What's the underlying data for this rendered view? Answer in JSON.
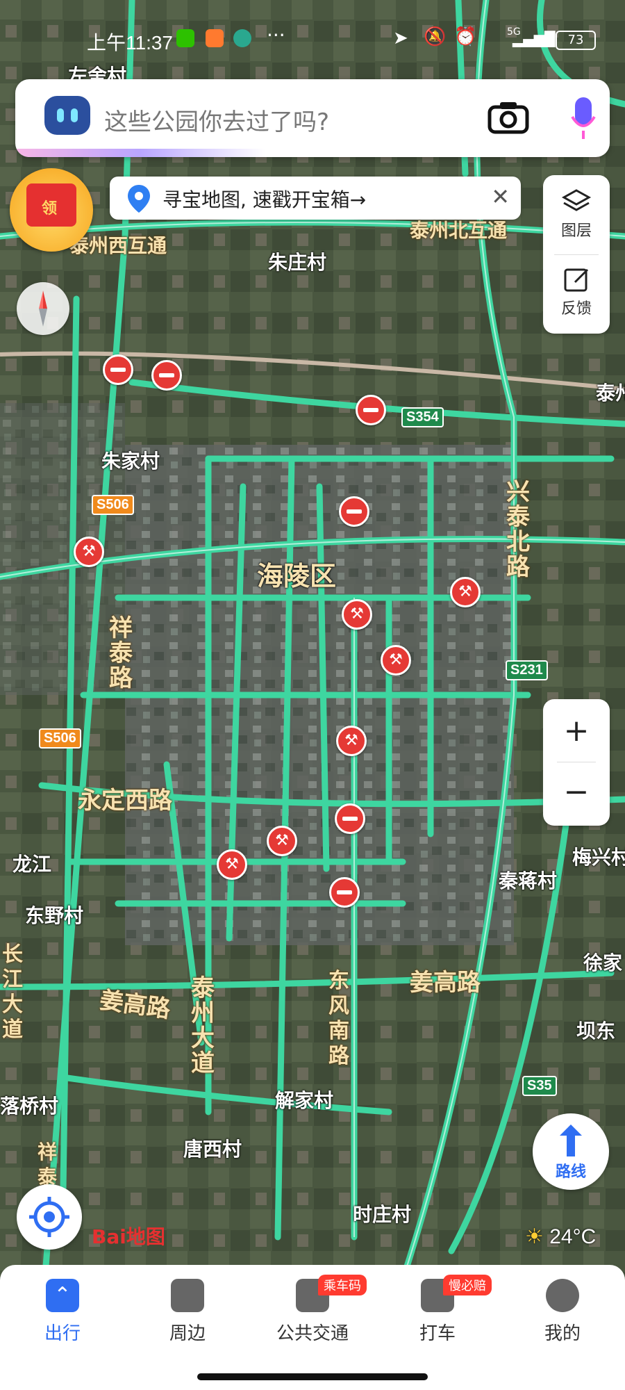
{
  "status_bar": {
    "time": "上午11:37",
    "battery": "73",
    "network": "5G"
  },
  "search": {
    "placeholder": "这些公园你去过了吗?"
  },
  "banner": {
    "text": "寻宝地图, 速戳开宝箱→"
  },
  "envelope": {
    "label": "领"
  },
  "right_panel": {
    "layers_label": "图层",
    "feedback_label": "反馈"
  },
  "map": {
    "district": "海陵区",
    "places": [
      "左舍村",
      "朱庄村",
      "泰州西互通",
      "泰州北互通",
      "朱家村",
      "龙江",
      "东野村",
      "秦蒋村",
      "梅兴村",
      "徐家",
      "坝东",
      "解家村",
      "唐西村",
      "时庄村",
      "落桥村",
      "泰州"
    ],
    "roads": [
      "永定西路",
      "姜高路",
      "姜高路",
      "兴泰北路",
      "祥泰路",
      "泰州大道",
      "东风南路",
      "长江大道",
      "祥泰"
    ],
    "shields": [
      "S354",
      "S506",
      "S506",
      "S231",
      "S35"
    ]
  },
  "zoom": {
    "in": "+",
    "out": "−"
  },
  "route": {
    "label": "路线"
  },
  "logo": "Bai地图",
  "weather": {
    "temp": "24°C"
  },
  "tabs": [
    {
      "label": "出行",
      "active": true
    },
    {
      "label": "周边"
    },
    {
      "label": "公共交通",
      "badge": "乘车码"
    },
    {
      "label": "打车",
      "badge": "慢必赔"
    },
    {
      "label": "我的"
    }
  ],
  "colors": {
    "accent": "#2f6ef2",
    "road": "#3ed6a0",
    "alert": "#e53935"
  }
}
